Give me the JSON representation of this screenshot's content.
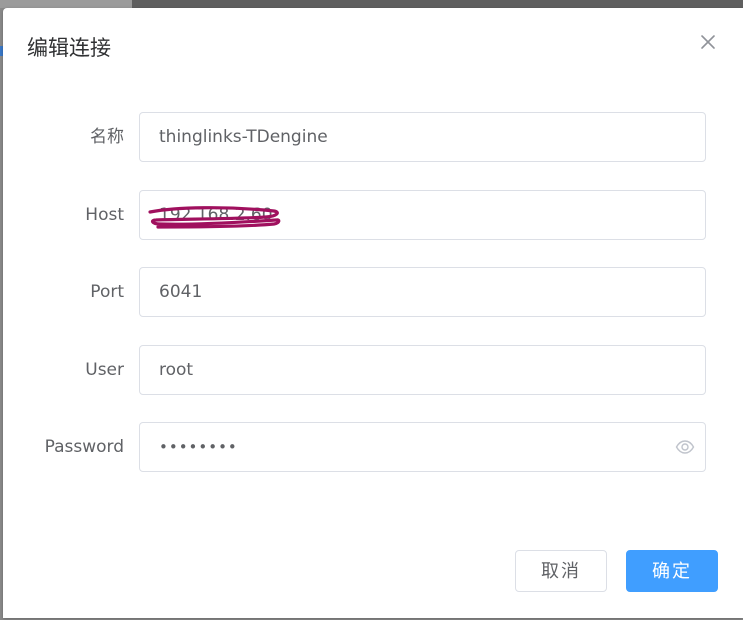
{
  "dialog": {
    "title": "编辑连接",
    "close_icon": "close-icon"
  },
  "form": {
    "name": {
      "label": "名称",
      "value": "thinglinks-TDengine"
    },
    "host": {
      "label": "Host",
      "value": "192.168.2.60"
    },
    "port": {
      "label": "Port",
      "value": "6041"
    },
    "user": {
      "label": "User",
      "value": "root"
    },
    "password": {
      "label": "Password",
      "value": "taosdata",
      "toggle_icon": "eye-icon"
    }
  },
  "footer": {
    "cancel_label": "取消",
    "confirm_label": "确定"
  },
  "colors": {
    "primary": "#409eff",
    "border": "#dcdfe6",
    "label_text": "#606266",
    "title_text": "#303133",
    "redaction": "#a0105e"
  }
}
